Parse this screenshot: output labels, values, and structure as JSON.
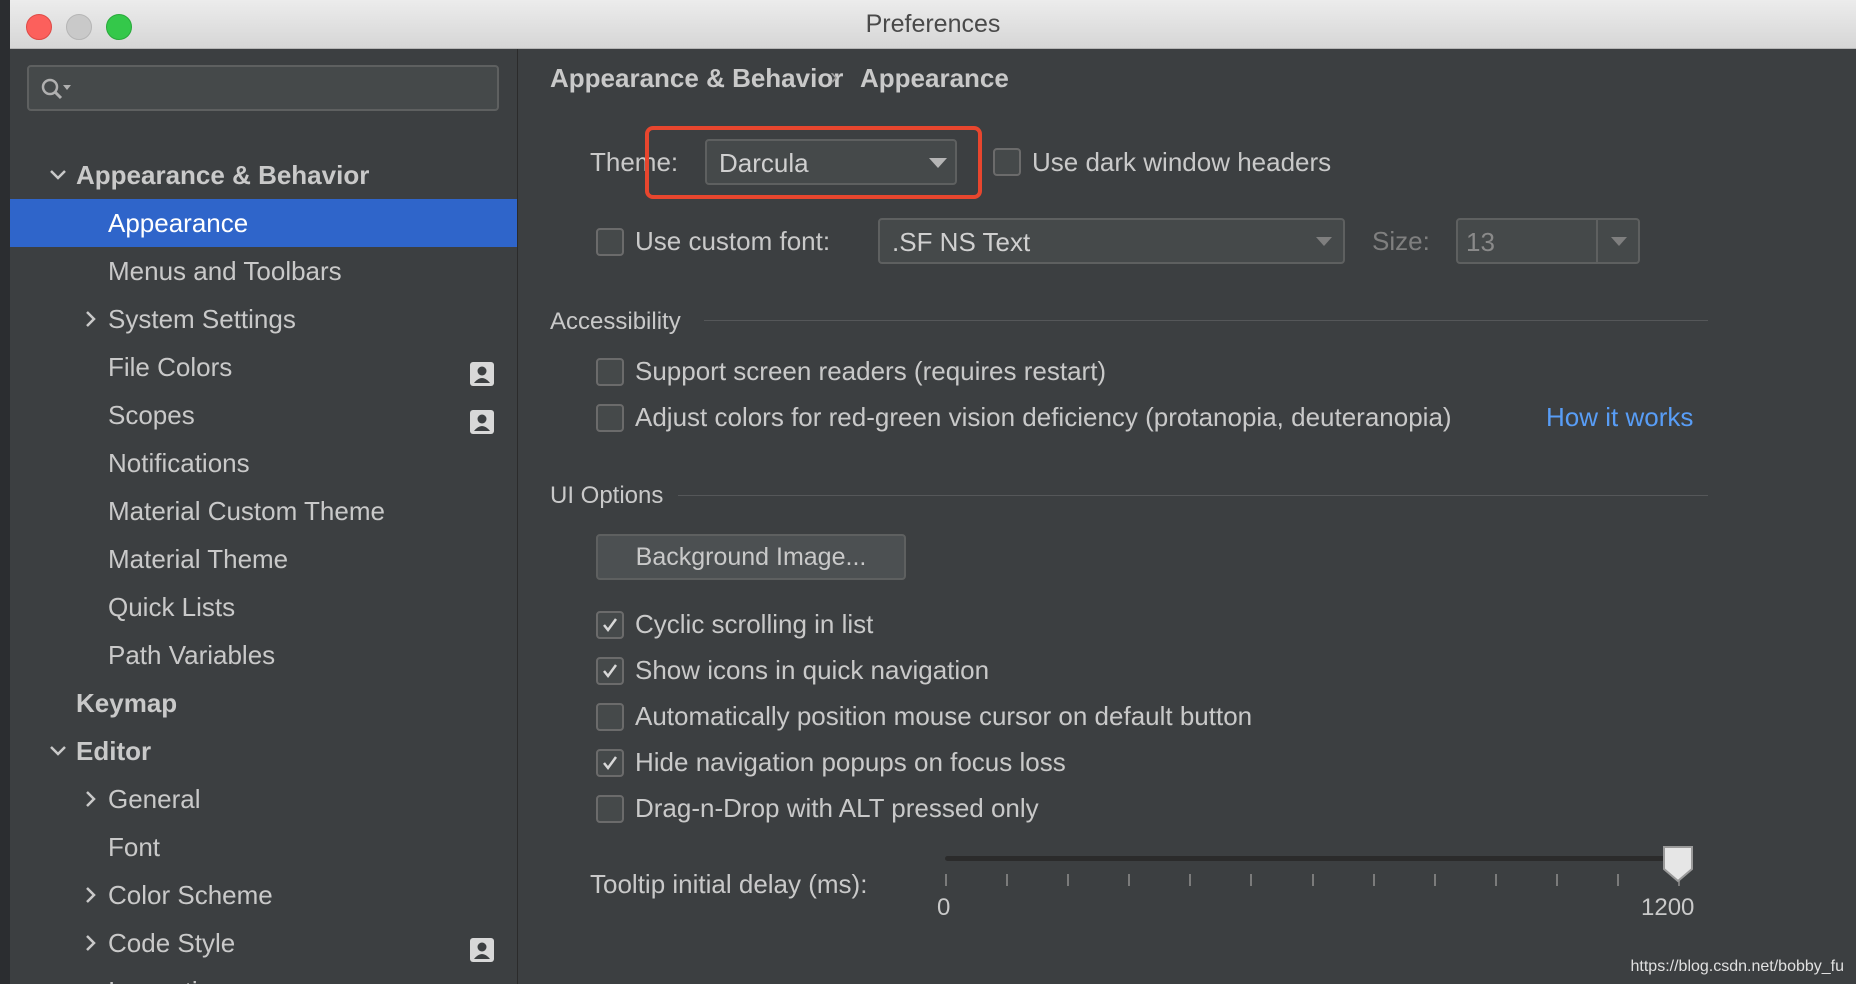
{
  "window": {
    "title": "Preferences"
  },
  "sidebar": {
    "search_placeholder": "",
    "items": [
      {
        "label": "Appearance & Behavior",
        "level": 0,
        "expanded": true,
        "bold": true
      },
      {
        "label": "Appearance",
        "level": 1,
        "selected": true
      },
      {
        "label": "Menus and Toolbars",
        "level": 1
      },
      {
        "label": "System Settings",
        "level": 1,
        "expandable": true
      },
      {
        "label": "File Colors",
        "level": 1,
        "badge": "project-icon"
      },
      {
        "label": "Scopes",
        "level": 1,
        "badge": "project-icon"
      },
      {
        "label": "Notifications",
        "level": 1
      },
      {
        "label": "Material Custom Theme",
        "level": 1
      },
      {
        "label": "Material Theme",
        "level": 1
      },
      {
        "label": "Quick Lists",
        "level": 1
      },
      {
        "label": "Path Variables",
        "level": 1
      },
      {
        "label": "Keymap",
        "level": 0,
        "bold": true
      },
      {
        "label": "Editor",
        "level": 0,
        "expanded": true,
        "bold": true
      },
      {
        "label": "General",
        "level": 1,
        "expandable": true
      },
      {
        "label": "Font",
        "level": 1
      },
      {
        "label": "Color Scheme",
        "level": 1,
        "expandable": true
      },
      {
        "label": "Code Style",
        "level": 1,
        "expandable": true,
        "badge": "project-icon"
      },
      {
        "label": "Inspections",
        "level": 1,
        "badge": "project-icon"
      }
    ]
  },
  "breadcrumb": {
    "parent": "Appearance & Behavior",
    "separator": "›",
    "current": "Appearance"
  },
  "theme": {
    "label": "Theme:",
    "value": "Darcula"
  },
  "dark_headers": {
    "label": "Use dark window headers",
    "checked": false
  },
  "custom_font": {
    "label": "Use custom font:",
    "checked": false,
    "font_value": ".SF NS Text",
    "size_label": "Size:",
    "size_value": "13"
  },
  "accessibility": {
    "title": "Accessibility",
    "screen_readers": {
      "label": "Support screen readers (requires restart)",
      "checked": false
    },
    "color_deficiency": {
      "label": "Adjust colors for red-green vision deficiency (protanopia, deuteranopia)",
      "checked": false
    },
    "link": "How it works"
  },
  "ui_options": {
    "title": "UI Options",
    "background_button": "Background Image...",
    "options": [
      {
        "label": "Cyclic scrolling in list",
        "checked": true
      },
      {
        "label": "Show icons in quick navigation",
        "checked": true
      },
      {
        "label": "Automatically position mouse cursor on default button",
        "checked": false
      },
      {
        "label": "Hide navigation popups on focus loss",
        "checked": true
      },
      {
        "label": "Drag-n-Drop with ALT pressed only",
        "checked": false
      }
    ]
  },
  "tooltip_delay": {
    "label": "Tooltip initial delay (ms):",
    "min_label": "0",
    "max_label": "1200",
    "value": 1200,
    "max": 1200
  },
  "watermark": "https://blog.csdn.net/bobby_fu",
  "colors": {
    "selection": "#2f65ca",
    "link": "#589df6",
    "highlight": "#e8462e",
    "background": "#3c3f41"
  }
}
